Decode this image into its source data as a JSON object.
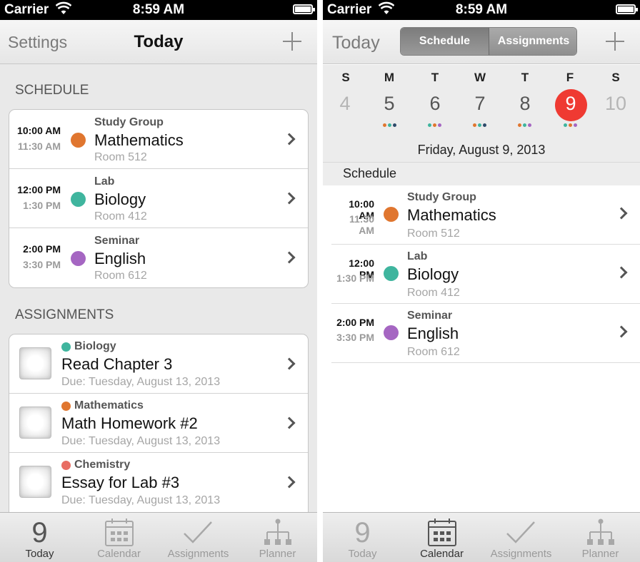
{
  "status_bar": {
    "carrier": "Carrier",
    "time": "8:59 AM"
  },
  "left_screen": {
    "nav": {
      "left_button": "Settings",
      "title": "Today"
    },
    "schedule_header": "SCHEDULE",
    "schedule": [
      {
        "start": "10:00 AM",
        "end": "11:30 AM",
        "kind": "Study Group",
        "subject": "Mathematics",
        "room": "Room 512",
        "color": "#e0762f"
      },
      {
        "start": "12:00 PM",
        "end": "1:30 PM",
        "kind": "Lab",
        "subject": "Biology",
        "room": "Room 412",
        "color": "#3fb59e"
      },
      {
        "start": "2:00 PM",
        "end": "3:30 PM",
        "kind": "Seminar",
        "subject": "English",
        "room": "Room 612",
        "color": "#a566c2"
      }
    ],
    "assignments_header": "ASSIGNMENTS",
    "assignments": [
      {
        "category": "Biology",
        "title": "Read Chapter 3",
        "due": "Due: Tuesday, August 13, 2013",
        "color": "#3fb59e"
      },
      {
        "category": "Mathematics",
        "title": "Math Homework #2",
        "due": "Due: Tuesday, August 13, 2013",
        "color": "#e0762f"
      },
      {
        "category": "Chemistry",
        "title": "Essay for Lab #3",
        "due": "Due: Tuesday, August 13, 2013",
        "color": "#e86d63"
      }
    ],
    "tabbar": {
      "today_number": "9",
      "active": "Today"
    }
  },
  "right_screen": {
    "nav": {
      "left_button": "Today",
      "segments": [
        "Schedule",
        "Assignments"
      ],
      "selected_segment": "Schedule"
    },
    "week": {
      "days_of_week": [
        "S",
        "M",
        "T",
        "W",
        "T",
        "F",
        "S"
      ],
      "dates": [
        "4",
        "5",
        "6",
        "7",
        "8",
        "9",
        "10"
      ],
      "selected_date": "9",
      "selected_label": "Friday, August 9, 2013"
    },
    "schedule_header": "Schedule",
    "schedule": [
      {
        "start": "10:00 AM",
        "end": "11:30 AM",
        "kind": "Study Group",
        "subject": "Mathematics",
        "room": "Room 512",
        "color": "#e0762f"
      },
      {
        "start": "12:00 PM",
        "end": "1:30 PM",
        "kind": "Lab",
        "subject": "Biology",
        "room": "Room 412",
        "color": "#3fb59e"
      },
      {
        "start": "2:00 PM",
        "end": "3:30 PM",
        "kind": "Seminar",
        "subject": "English",
        "room": "Room 612",
        "color": "#a566c2"
      }
    ],
    "tabbar": {
      "today_number": "9",
      "active": "Calendar"
    }
  },
  "tabbar_labels": {
    "today": "Today",
    "calendar": "Calendar",
    "assignments": "Assignments",
    "planner": "Planner"
  },
  "colors": {
    "today_highlight": "#ef3a32",
    "dot_orange": "#e0762f",
    "dot_teal": "#3fb59e",
    "dot_purple": "#a566c2",
    "dot_navy": "#2e4a6b"
  }
}
